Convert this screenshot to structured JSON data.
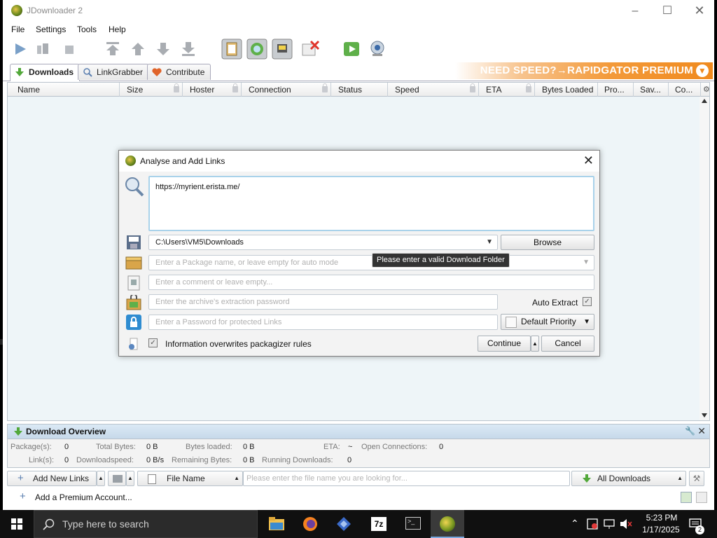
{
  "window": {
    "title": "JDownloader 2"
  },
  "menu": [
    "File",
    "Settings",
    "Tools",
    "Help"
  ],
  "tabs": [
    {
      "label": "Downloads",
      "active": true
    },
    {
      "label": "LinkGrabber",
      "active": false
    },
    {
      "label": "Contribute",
      "active": false
    }
  ],
  "banner": {
    "text": "NEED SPEED?→RAPIDGATOR PREMIUM"
  },
  "columns": [
    "Name",
    "Size",
    "Hoster",
    "Connection",
    "Status",
    "Speed",
    "ETA",
    "Bytes Loaded",
    "Pro...",
    "Sav...",
    "Co..."
  ],
  "overview": {
    "title": "Download Overview",
    "labels": {
      "packages": "Package(s):",
      "total_bytes": "Total Bytes:",
      "bytes_loaded": "Bytes loaded:",
      "eta": "ETA:",
      "open_connections": "Open Connections:",
      "links": "Link(s):",
      "download_speed": "Downloadspeed:",
      "remaining_bytes": "Remaining Bytes:",
      "running_downloads": "Running Downloads:"
    },
    "values": {
      "packages": "0",
      "total_bytes": "0 B",
      "bytes_loaded": "0 B",
      "eta": "~",
      "open_connections": "0",
      "links": "0",
      "download_speed": "0 B/s",
      "remaining_bytes": "0 B",
      "running_downloads": "0"
    }
  },
  "bottombar": {
    "add_links": "Add New Links",
    "file_name": "File Name",
    "search_placeholder": "Please enter the file name you are looking for...",
    "filter": "All Downloads"
  },
  "premium": {
    "add_account": "Add a Premium Account..."
  },
  "dialog": {
    "title": "Analyse and Add Links",
    "links_value": "https://myrient.erista.me/",
    "folder_value": "C:\\Users\\VM5\\Downloads",
    "browse": "Browse",
    "package_placeholder": "Enter a Package name, or leave empty for auto mode",
    "comment_placeholder": "Enter a comment or leave empty...",
    "archive_password_placeholder": "Enter the archive's extraction password",
    "auto_extract": "Auto Extract",
    "links_password_placeholder": "Enter a Password for protected Links",
    "priority": "Default Priority",
    "overwrite_rules": "Information overwrites packagizer rules",
    "continue": "Continue",
    "cancel": "Cancel",
    "tooltip": "Please enter a valid Download Folder"
  },
  "taskbar": {
    "search_placeholder": "Type here to search",
    "time": "5:23 PM",
    "date": "1/17/2025",
    "notification_count": "2"
  },
  "colors": {
    "banner": "#f08a1e",
    "table_bg": "#eef5f8",
    "taskbar": "#101010"
  }
}
